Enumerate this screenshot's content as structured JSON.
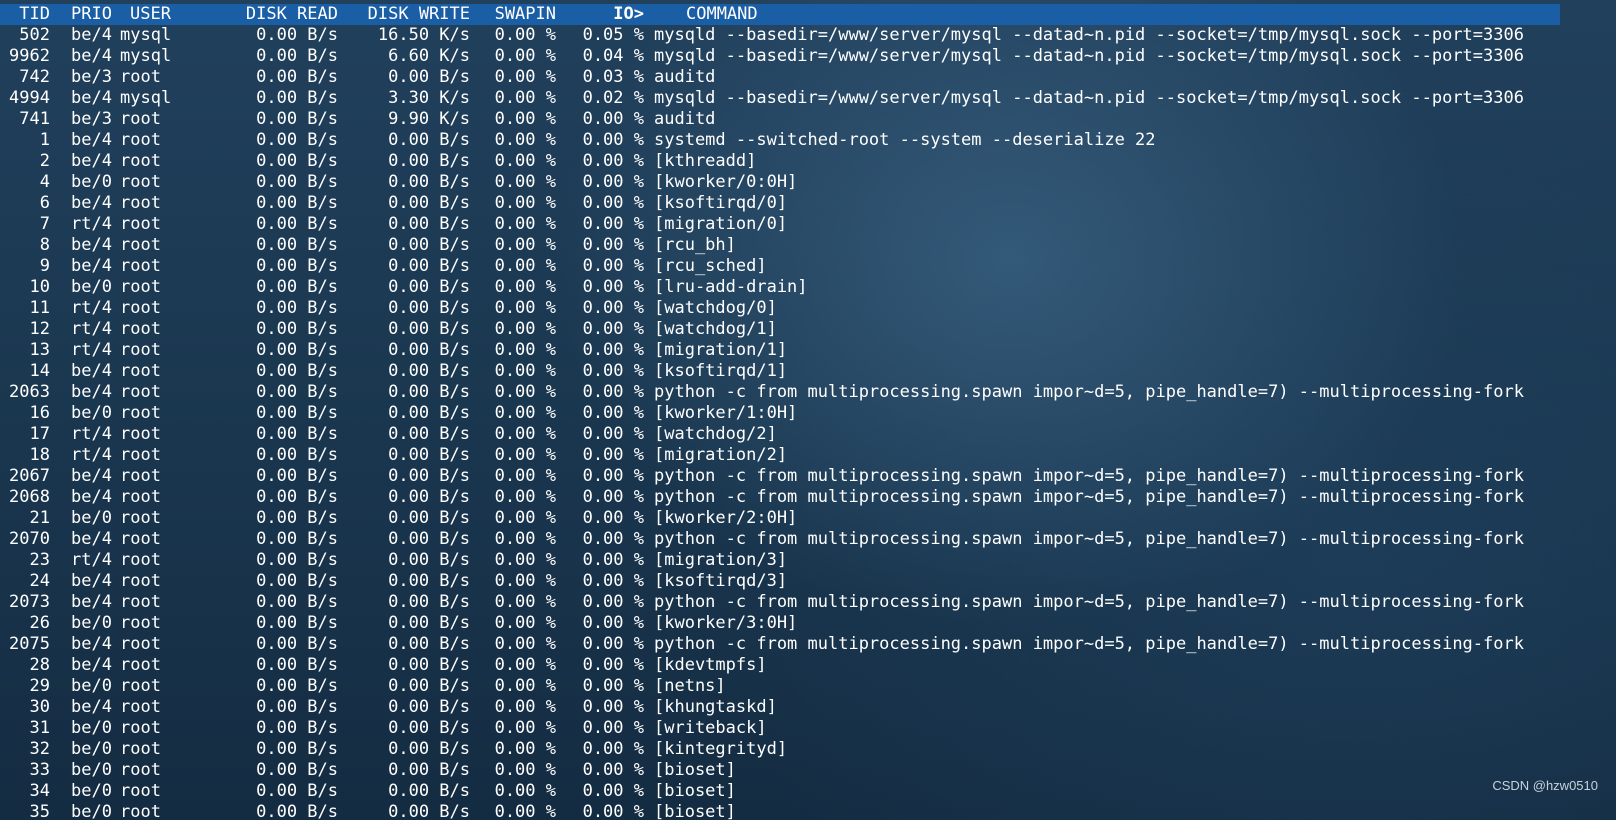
{
  "header": {
    "tid": "TID",
    "prio": "PRIO",
    "user": "USER",
    "disk_read": "DISK READ",
    "disk_write": "DISK WRITE",
    "swapin": "SWAPIN",
    "io": "IO>",
    "command": "COMMAND"
  },
  "colors": {
    "header_bg": "#1a5ea6",
    "text": "#ffffff",
    "background_top": "#21405c",
    "background_bottom": "#142c42"
  },
  "rows": [
    {
      "tid": "502",
      "prio": "be/4",
      "user": "mysql",
      "read": "0.00 B/s",
      "write": "16.50 K/s",
      "swapin": "0.00 %",
      "io": "0.05 %",
      "cmd": "mysqld --basedir=/www/server/mysql --datad~n.pid --socket=/tmp/mysql.sock --port=3306"
    },
    {
      "tid": "9962",
      "prio": "be/4",
      "user": "mysql",
      "read": "0.00 B/s",
      "write": "6.60 K/s",
      "swapin": "0.00 %",
      "io": "0.04 %",
      "cmd": "mysqld --basedir=/www/server/mysql --datad~n.pid --socket=/tmp/mysql.sock --port=3306"
    },
    {
      "tid": "742",
      "prio": "be/3",
      "user": "root",
      "read": "0.00 B/s",
      "write": "0.00 B/s",
      "swapin": "0.00 %",
      "io": "0.03 %",
      "cmd": "auditd"
    },
    {
      "tid": "4994",
      "prio": "be/4",
      "user": "mysql",
      "read": "0.00 B/s",
      "write": "3.30 K/s",
      "swapin": "0.00 %",
      "io": "0.02 %",
      "cmd": "mysqld --basedir=/www/server/mysql --datad~n.pid --socket=/tmp/mysql.sock --port=3306"
    },
    {
      "tid": "741",
      "prio": "be/3",
      "user": "root",
      "read": "0.00 B/s",
      "write": "9.90 K/s",
      "swapin": "0.00 %",
      "io": "0.00 %",
      "cmd": "auditd"
    },
    {
      "tid": "1",
      "prio": "be/4",
      "user": "root",
      "read": "0.00 B/s",
      "write": "0.00 B/s",
      "swapin": "0.00 %",
      "io": "0.00 %",
      "cmd": "systemd --switched-root --system --deserialize 22"
    },
    {
      "tid": "2",
      "prio": "be/4",
      "user": "root",
      "read": "0.00 B/s",
      "write": "0.00 B/s",
      "swapin": "0.00 %",
      "io": "0.00 %",
      "cmd": "[kthreadd]"
    },
    {
      "tid": "4",
      "prio": "be/0",
      "user": "root",
      "read": "0.00 B/s",
      "write": "0.00 B/s",
      "swapin": "0.00 %",
      "io": "0.00 %",
      "cmd": "[kworker/0:0H]"
    },
    {
      "tid": "6",
      "prio": "be/4",
      "user": "root",
      "read": "0.00 B/s",
      "write": "0.00 B/s",
      "swapin": "0.00 %",
      "io": "0.00 %",
      "cmd": "[ksoftirqd/0]"
    },
    {
      "tid": "7",
      "prio": "rt/4",
      "user": "root",
      "read": "0.00 B/s",
      "write": "0.00 B/s",
      "swapin": "0.00 %",
      "io": "0.00 %",
      "cmd": "[migration/0]"
    },
    {
      "tid": "8",
      "prio": "be/4",
      "user": "root",
      "read": "0.00 B/s",
      "write": "0.00 B/s",
      "swapin": "0.00 %",
      "io": "0.00 %",
      "cmd": "[rcu_bh]"
    },
    {
      "tid": "9",
      "prio": "be/4",
      "user": "root",
      "read": "0.00 B/s",
      "write": "0.00 B/s",
      "swapin": "0.00 %",
      "io": "0.00 %",
      "cmd": "[rcu_sched]"
    },
    {
      "tid": "10",
      "prio": "be/0",
      "user": "root",
      "read": "0.00 B/s",
      "write": "0.00 B/s",
      "swapin": "0.00 %",
      "io": "0.00 %",
      "cmd": "[lru-add-drain]"
    },
    {
      "tid": "11",
      "prio": "rt/4",
      "user": "root",
      "read": "0.00 B/s",
      "write": "0.00 B/s",
      "swapin": "0.00 %",
      "io": "0.00 %",
      "cmd": "[watchdog/0]"
    },
    {
      "tid": "12",
      "prio": "rt/4",
      "user": "root",
      "read": "0.00 B/s",
      "write": "0.00 B/s",
      "swapin": "0.00 %",
      "io": "0.00 %",
      "cmd": "[watchdog/1]"
    },
    {
      "tid": "13",
      "prio": "rt/4",
      "user": "root",
      "read": "0.00 B/s",
      "write": "0.00 B/s",
      "swapin": "0.00 %",
      "io": "0.00 %",
      "cmd": "[migration/1]"
    },
    {
      "tid": "14",
      "prio": "be/4",
      "user": "root",
      "read": "0.00 B/s",
      "write": "0.00 B/s",
      "swapin": "0.00 %",
      "io": "0.00 %",
      "cmd": "[ksoftirqd/1]"
    },
    {
      "tid": "2063",
      "prio": "be/4",
      "user": "root",
      "read": "0.00 B/s",
      "write": "0.00 B/s",
      "swapin": "0.00 %",
      "io": "0.00 %",
      "cmd": "python -c from multiprocessing.spawn impor~d=5, pipe_handle=7) --multiprocessing-fork"
    },
    {
      "tid": "16",
      "prio": "be/0",
      "user": "root",
      "read": "0.00 B/s",
      "write": "0.00 B/s",
      "swapin": "0.00 %",
      "io": "0.00 %",
      "cmd": "[kworker/1:0H]"
    },
    {
      "tid": "17",
      "prio": "rt/4",
      "user": "root",
      "read": "0.00 B/s",
      "write": "0.00 B/s",
      "swapin": "0.00 %",
      "io": "0.00 %",
      "cmd": "[watchdog/2]"
    },
    {
      "tid": "18",
      "prio": "rt/4",
      "user": "root",
      "read": "0.00 B/s",
      "write": "0.00 B/s",
      "swapin": "0.00 %",
      "io": "0.00 %",
      "cmd": "[migration/2]"
    },
    {
      "tid": "2067",
      "prio": "be/4",
      "user": "root",
      "read": "0.00 B/s",
      "write": "0.00 B/s",
      "swapin": "0.00 %",
      "io": "0.00 %",
      "cmd": "python -c from multiprocessing.spawn impor~d=5, pipe_handle=7) --multiprocessing-fork"
    },
    {
      "tid": "2068",
      "prio": "be/4",
      "user": "root",
      "read": "0.00 B/s",
      "write": "0.00 B/s",
      "swapin": "0.00 %",
      "io": "0.00 %",
      "cmd": "python -c from multiprocessing.spawn impor~d=5, pipe_handle=7) --multiprocessing-fork"
    },
    {
      "tid": "21",
      "prio": "be/0",
      "user": "root",
      "read": "0.00 B/s",
      "write": "0.00 B/s",
      "swapin": "0.00 %",
      "io": "0.00 %",
      "cmd": "[kworker/2:0H]"
    },
    {
      "tid": "2070",
      "prio": "be/4",
      "user": "root",
      "read": "0.00 B/s",
      "write": "0.00 B/s",
      "swapin": "0.00 %",
      "io": "0.00 %",
      "cmd": "python -c from multiprocessing.spawn impor~d=5, pipe_handle=7) --multiprocessing-fork"
    },
    {
      "tid": "23",
      "prio": "rt/4",
      "user": "root",
      "read": "0.00 B/s",
      "write": "0.00 B/s",
      "swapin": "0.00 %",
      "io": "0.00 %",
      "cmd": "[migration/3]"
    },
    {
      "tid": "24",
      "prio": "be/4",
      "user": "root",
      "read": "0.00 B/s",
      "write": "0.00 B/s",
      "swapin": "0.00 %",
      "io": "0.00 %",
      "cmd": "[ksoftirqd/3]"
    },
    {
      "tid": "2073",
      "prio": "be/4",
      "user": "root",
      "read": "0.00 B/s",
      "write": "0.00 B/s",
      "swapin": "0.00 %",
      "io": "0.00 %",
      "cmd": "python -c from multiprocessing.spawn impor~d=5, pipe_handle=7) --multiprocessing-fork"
    },
    {
      "tid": "26",
      "prio": "be/0",
      "user": "root",
      "read": "0.00 B/s",
      "write": "0.00 B/s",
      "swapin": "0.00 %",
      "io": "0.00 %",
      "cmd": "[kworker/3:0H]"
    },
    {
      "tid": "2075",
      "prio": "be/4",
      "user": "root",
      "read": "0.00 B/s",
      "write": "0.00 B/s",
      "swapin": "0.00 %",
      "io": "0.00 %",
      "cmd": "python -c from multiprocessing.spawn impor~d=5, pipe_handle=7) --multiprocessing-fork"
    },
    {
      "tid": "28",
      "prio": "be/4",
      "user": "root",
      "read": "0.00 B/s",
      "write": "0.00 B/s",
      "swapin": "0.00 %",
      "io": "0.00 %",
      "cmd": "[kdevtmpfs]"
    },
    {
      "tid": "29",
      "prio": "be/0",
      "user": "root",
      "read": "0.00 B/s",
      "write": "0.00 B/s",
      "swapin": "0.00 %",
      "io": "0.00 %",
      "cmd": "[netns]"
    },
    {
      "tid": "30",
      "prio": "be/4",
      "user": "root",
      "read": "0.00 B/s",
      "write": "0.00 B/s",
      "swapin": "0.00 %",
      "io": "0.00 %",
      "cmd": "[khungtaskd]"
    },
    {
      "tid": "31",
      "prio": "be/0",
      "user": "root",
      "read": "0.00 B/s",
      "write": "0.00 B/s",
      "swapin": "0.00 %",
      "io": "0.00 %",
      "cmd": "[writeback]"
    },
    {
      "tid": "32",
      "prio": "be/0",
      "user": "root",
      "read": "0.00 B/s",
      "write": "0.00 B/s",
      "swapin": "0.00 %",
      "io": "0.00 %",
      "cmd": "[kintegrityd]"
    },
    {
      "tid": "33",
      "prio": "be/0",
      "user": "root",
      "read": "0.00 B/s",
      "write": "0.00 B/s",
      "swapin": "0.00 %",
      "io": "0.00 %",
      "cmd": "[bioset]"
    },
    {
      "tid": "34",
      "prio": "be/0",
      "user": "root",
      "read": "0.00 B/s",
      "write": "0.00 B/s",
      "swapin": "0.00 %",
      "io": "0.00 %",
      "cmd": "[bioset]"
    },
    {
      "tid": "35",
      "prio": "be/0",
      "user": "root",
      "read": "0.00 B/s",
      "write": "0.00 B/s",
      "swapin": "0.00 %",
      "io": "0.00 %",
      "cmd": "[bioset]"
    }
  ],
  "watermark": "CSDN @hzw0510"
}
